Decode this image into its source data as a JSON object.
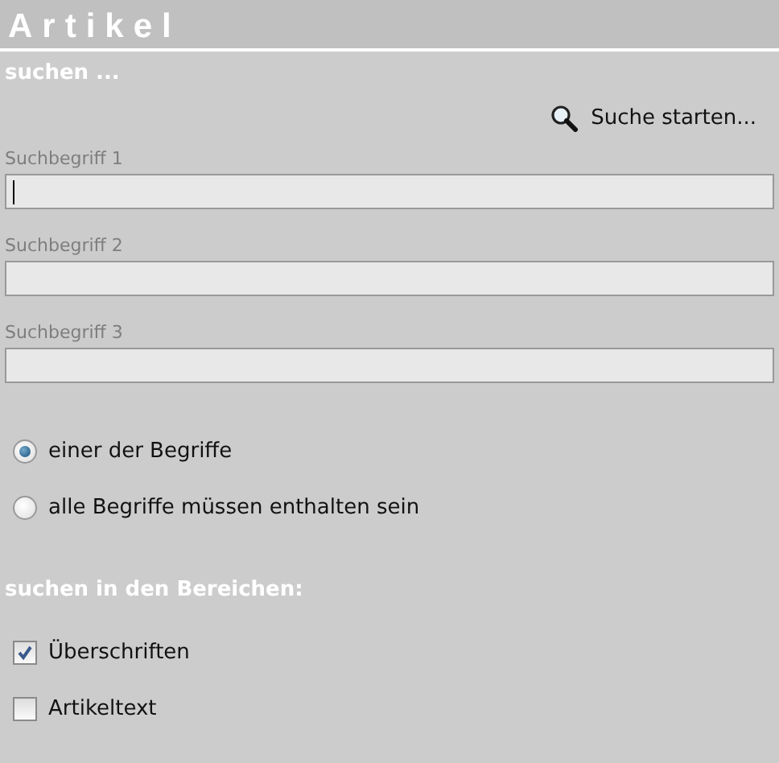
{
  "title": "Artikel",
  "subtitle": "suchen ...",
  "search_button": {
    "label": "Suche starten..."
  },
  "fields": [
    {
      "label": "Suchbegriff 1",
      "focused": true
    },
    {
      "label": "Suchbegriff 2",
      "focused": false
    },
    {
      "label": "Suchbegriff 3",
      "focused": false
    }
  ],
  "match_options": [
    {
      "label": "einer der Begriffe",
      "selected": true
    },
    {
      "label": "alle Begriffe müssen enthalten sein",
      "selected": false
    }
  ],
  "areas_heading": "suchen in den Bereichen:",
  "areas": [
    {
      "label": "Überschriften",
      "checked": true
    },
    {
      "label": "Artikeltext",
      "checked": false
    }
  ]
}
